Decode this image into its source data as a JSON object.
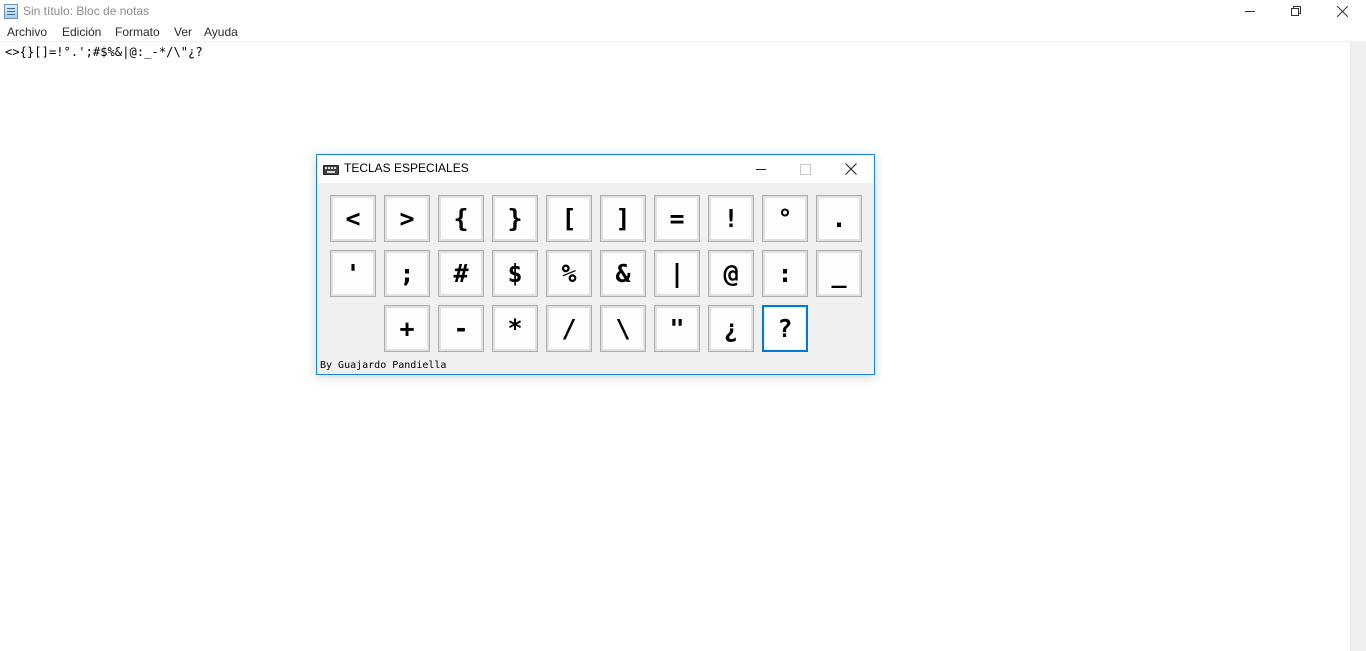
{
  "notepad": {
    "title": "Sin título: Bloc de notas",
    "menu": [
      "Archivo",
      "Edición",
      "Formato",
      "Ver",
      "Ayuda"
    ],
    "content": "<>{}[]=!°.';#$%&|@:_-*/\\\"¿?"
  },
  "dialog": {
    "title": "TECLAS ESPECIALES",
    "credit": "By Guajardo Pandiella",
    "keys_row1": [
      "<",
      ">",
      "{",
      "}",
      "[",
      "]",
      "=",
      "!",
      "°",
      "."
    ],
    "keys_row2": [
      "'",
      ";",
      "#",
      "$",
      "%",
      "&",
      "|",
      "@",
      ":",
      "_"
    ],
    "keys_row3": [
      "+",
      "-",
      "*",
      "/",
      "\\",
      "\"",
      "¿",
      "?"
    ],
    "focused_key": "?"
  },
  "colors": {
    "dialog_border": "#1883d7",
    "focus_border": "#0078d7",
    "dialog_bg": "#f0f0f0"
  },
  "icons": {
    "app": "notepad-icon",
    "dialog": "keyboard-icon"
  }
}
